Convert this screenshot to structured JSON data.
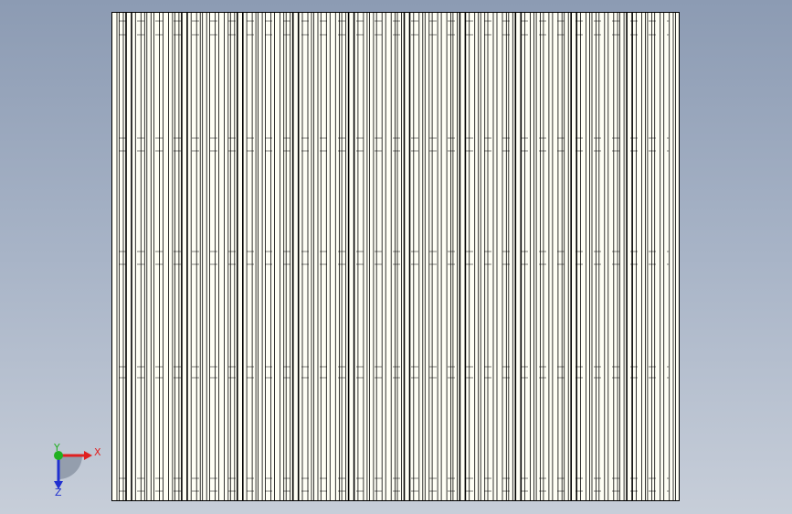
{
  "viewport": {
    "background_top": "#8c9bb3",
    "background_bottom": "#c7ced9",
    "drawing_fill": "#fffff5",
    "line_color": "#000000"
  },
  "triad": {
    "x_label": "X",
    "y_label": "Y",
    "z_label": "Z",
    "x_color": "#e02020",
    "y_color": "#20b020",
    "z_color": "#2030d0"
  }
}
